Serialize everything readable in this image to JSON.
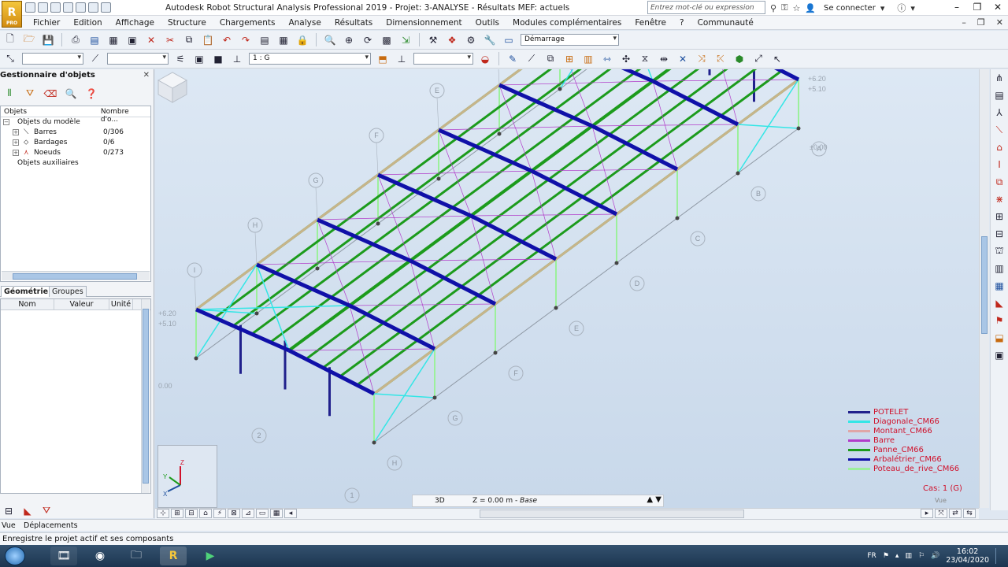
{
  "window": {
    "title": "Autodesk Robot Structural Analysis Professional 2019 - Projet: 3-ANALYSE - Résultats MEF: actuels",
    "logo_text": "R",
    "logo_sub": "PRO",
    "search_placeholder": "Entrez mot-clé ou expression",
    "login": "Se connecter"
  },
  "menu": {
    "items": [
      "Fichier",
      "Edition",
      "Affichage",
      "Structure",
      "Chargements",
      "Analyse",
      "Résultats",
      "Dimensionnement",
      "Outils",
      "Modules complémentaires",
      "Fenêtre",
      "?",
      "Communauté"
    ]
  },
  "toolbar": {
    "layout_combo": "Démarrage",
    "case_combo": "1 : G"
  },
  "object_manager": {
    "title": "Gestionnaire d'objets",
    "col_objects": "Objets",
    "col_count": "Nombre d'o...",
    "root": "Objets du modèle",
    "items": [
      {
        "label": "Barres",
        "count": "0/306"
      },
      {
        "label": "Bardages",
        "count": "0/6"
      },
      {
        "label": "Noeuds",
        "count": "0/273"
      }
    ],
    "aux": "Objets auxiliaires",
    "tabs": [
      "Géométrie",
      "Groupes"
    ],
    "prop_headers": [
      "Nom",
      "Valeur",
      "Unité"
    ]
  },
  "viewport": {
    "elevations_right": [
      "+6.20",
      "+5.10",
      "±0.00"
    ],
    "elevations_left": [
      "+6.20",
      "+5.10",
      "0.00"
    ],
    "axis_letters_top": [
      "C",
      "D",
      "E",
      "F",
      "G",
      "H",
      "I"
    ],
    "axis_numbers_top": [
      "2",
      "1"
    ],
    "axis_letters_bottom": [
      "A",
      "B",
      "C",
      "D",
      "E",
      "F",
      "G",
      "H"
    ],
    "axis_numbers_bottom": [
      "2",
      "1"
    ],
    "status_view": "3D",
    "status_z": "Z = 0.00 m",
    "status_plane": "Base",
    "case_label": "Cas: 1 (G)",
    "vue_label": "Vue"
  },
  "legend": [
    {
      "label": "POTELET",
      "color": "#20208c"
    },
    {
      "label": "Diagonale_CM66",
      "color": "#33e6e6"
    },
    {
      "label": "Montant_CM66",
      "color": "#e0a6a6"
    },
    {
      "label": "Barre",
      "color": "#b13cc9"
    },
    {
      "label": "Panne_CM66",
      "color": "#1c9b1c"
    },
    {
      "label": "Arbalétrier_CM66",
      "color": "#1010a8"
    },
    {
      "label": "Poteau_de_rive_CM66",
      "color": "#9cf09c"
    }
  ],
  "status": {
    "tabs": [
      "Vue",
      "Déplacements"
    ],
    "message": "Enregistre le projet actif et ses composants"
  },
  "taskbar": {
    "lang": "FR",
    "time": "16:02",
    "date": "23/04/2020"
  }
}
